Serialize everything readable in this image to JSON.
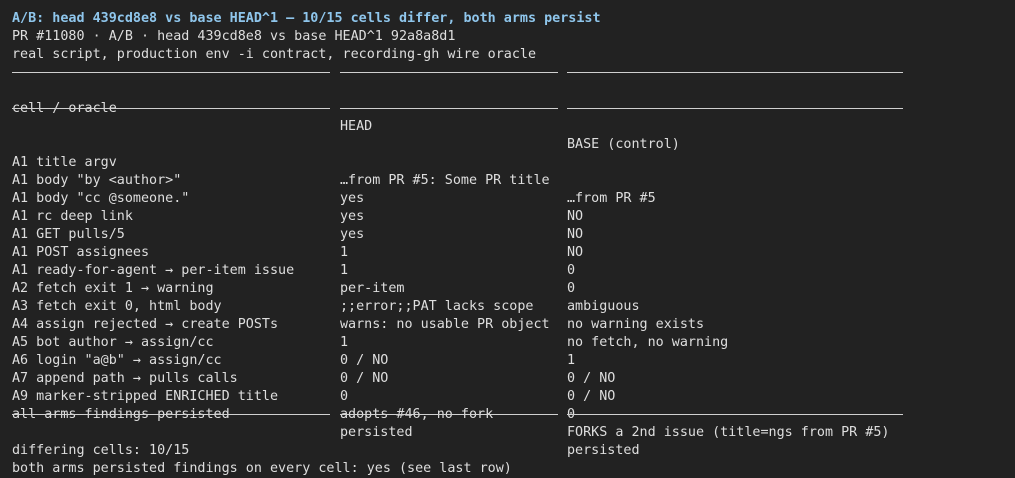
{
  "header": {
    "title": "A/B: head 439cd8e8 vs base HEAD^1 — 10/15 cells differ, both arms persist",
    "subtitle": "PR #11080 · A/B · head 439cd8e8 vs base HEAD^1 92a8a8d1",
    "context": "real script, production env -i contract, recording-gh wire oracle"
  },
  "table": {
    "columns": [
      "cell / oracle",
      "HEAD",
      "BASE (control)"
    ],
    "rows": [
      [
        "A1 title argv",
        "…from PR #5: Some PR title",
        "…from PR #5"
      ],
      [
        "A1 body \"by <author>\"",
        "yes",
        "NO"
      ],
      [
        "A1 body \"cc @someone.\"",
        "yes",
        "NO"
      ],
      [
        "A1 rc deep link",
        "yes",
        "NO"
      ],
      [
        "A1 GET pulls/5",
        "1",
        "0"
      ],
      [
        "A1 POST assignees",
        "1",
        "0"
      ],
      [
        "A1 ready-for-agent → per-item issue",
        "per-item",
        "ambiguous"
      ],
      [
        "A2 fetch exit 1 → warning",
        ";;error;;PAT lacks scope",
        "no warning exists"
      ],
      [
        "A3 fetch exit 0, html body",
        "warns: no usable PR object",
        "no fetch, no warning"
      ],
      [
        "A4 assign rejected → create POSTs",
        "1",
        "1"
      ],
      [
        "A5 bot author → assign/cc",
        "0 / NO",
        "0 / NO"
      ],
      [
        "A6 login \"a@b\" → assign/cc",
        "0 / NO",
        "0 / NO"
      ],
      [
        "A7 append path → pulls calls",
        "0",
        "0"
      ],
      [
        "A9 marker-stripped ENRICHED title",
        "adopts #46, no fork",
        "FORKS a 2nd issue (title=ngs from PR #5)"
      ],
      [
        "all arms findings persisted",
        "persisted",
        "persisted"
      ]
    ]
  },
  "summary": {
    "differing": "differing cells: 10/15",
    "persisted": "both arms persisted findings on every cell: yes (see last row)"
  },
  "colors": {
    "background": "#222222",
    "text": "#dedede",
    "title": "#8fc6ec"
  }
}
